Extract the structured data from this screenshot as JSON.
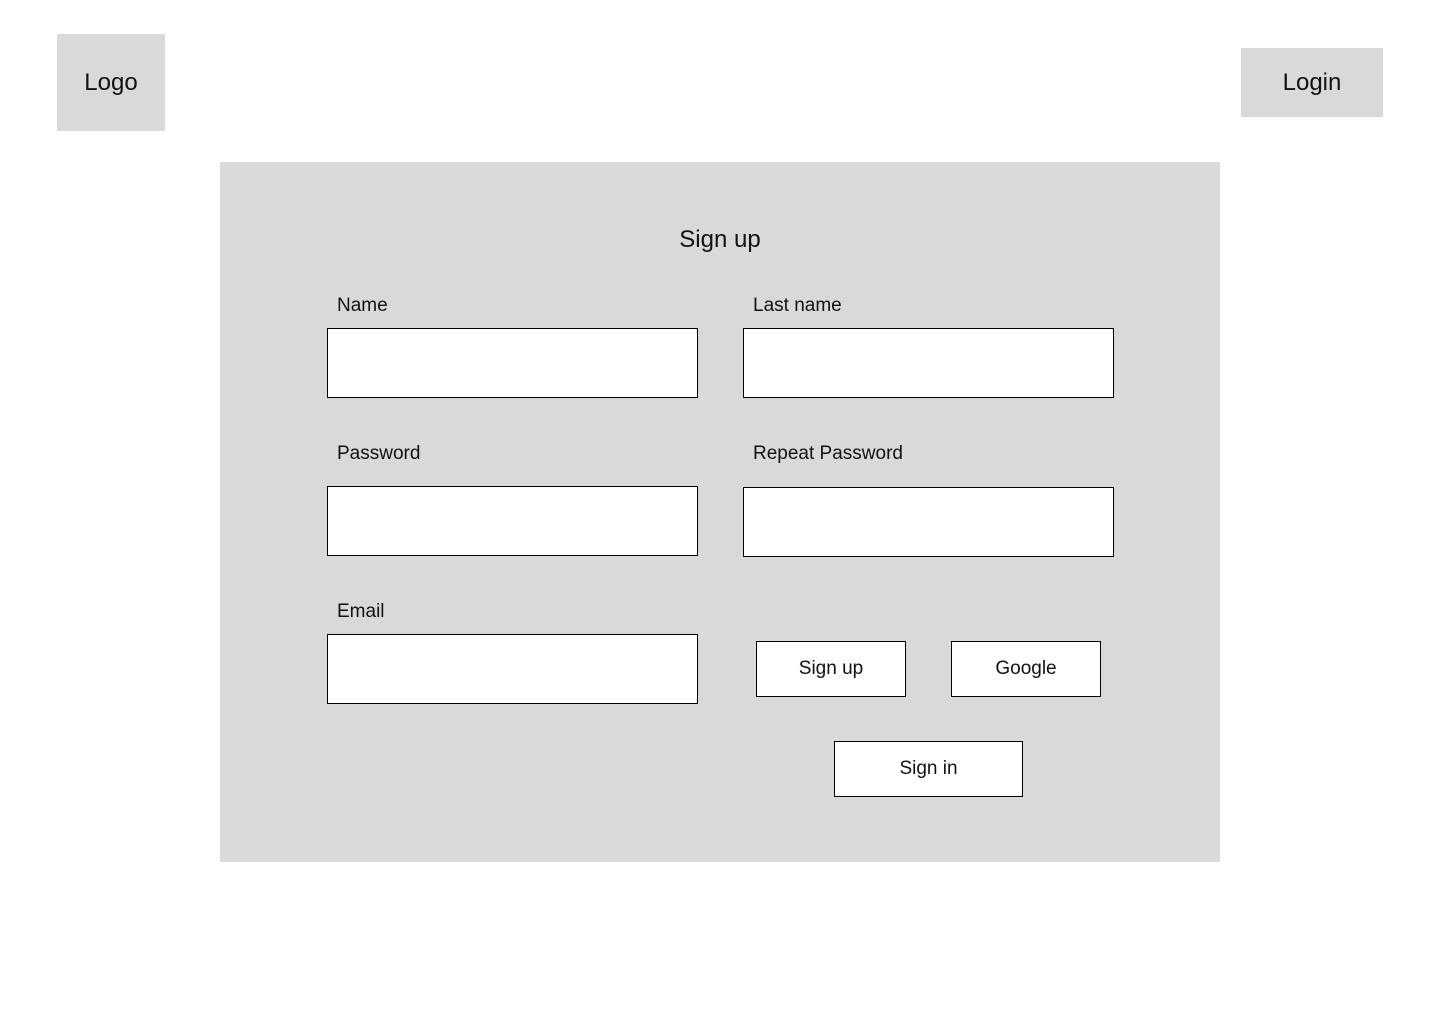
{
  "header": {
    "logo_text": "Logo",
    "login_label": "Login"
  },
  "form": {
    "title": "Sign up",
    "fields": {
      "name": {
        "label": "Name",
        "value": ""
      },
      "last_name": {
        "label": "Last name",
        "value": ""
      },
      "password": {
        "label": "Password",
        "value": ""
      },
      "repeat_password": {
        "label": "Repeat Password",
        "value": ""
      },
      "email": {
        "label": "Email",
        "value": ""
      }
    },
    "buttons": {
      "sign_up": "Sign up",
      "google": "Google",
      "sign_in": "Sign in"
    }
  },
  "colors": {
    "panel_background": "#D9D9D9",
    "page_background": "#FFFFFF",
    "input_border": "#000000"
  }
}
